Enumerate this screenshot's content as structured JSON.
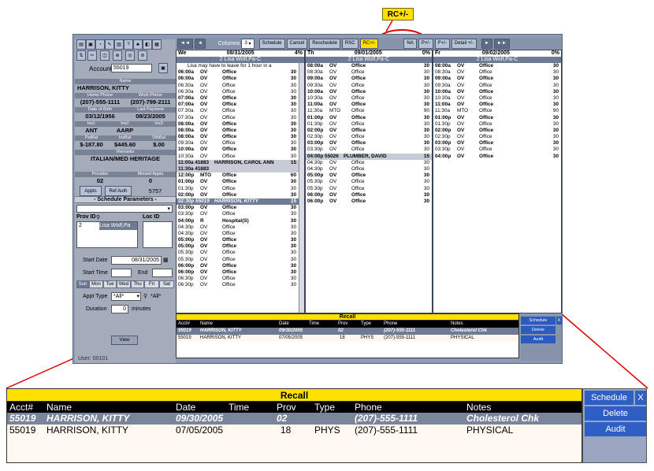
{
  "callout": {
    "label": "RC+/-"
  },
  "toolbar": {
    "nav_first": "◄◄",
    "nav_prev": "◄",
    "columns_label": "Columns",
    "columns_value": "3",
    "schedule": "Schedule",
    "cancel": "Cancel",
    "reschedule": "Reschedule",
    "rsc": "RSC",
    "rc_plus_minus": "RC+/-",
    "na": "NA",
    "p_plus": "P+/-",
    "f_plus": "F+/-",
    "detail": "Detail +/-",
    "nav_next": "►",
    "nav_last": "►►"
  },
  "account": {
    "label": "Account",
    "value": "55019",
    "name_label": "Name",
    "name": "HARRISON, KITTY",
    "home_phone_label": "Home Phone",
    "home_phone": "(207)-555-1111",
    "work_phone_label": "Work Phone",
    "work_phone": "(207)-799-2111",
    "dob_label": "Date of Birth",
    "dob": "03/12/1956",
    "last_payment_label": "Last Payment",
    "last_payment": "08/23/2005",
    "ins1_label": "Ins1",
    "ins1": "ANT",
    "ins2_label": "Ins2",
    "ins2": "AARP",
    "ins3_label": "Ins3",
    "patbal_label": "PatBal",
    "patbal": "$-187.80",
    "insbal_label": "InsBal",
    "insbal": "$445.60",
    "othbal_label": "OthBal",
    "othbal": "$.00",
    "remarks_label": "Remarks",
    "remarks": "ITALIAN/MED HERITAGE",
    "provider_label": "Provider",
    "provider": "02",
    "missed_label": "Missed Appts",
    "missed": "0",
    "appts_btn": "Appts",
    "refauth_btn": "Ref Auth",
    "auth_value": "5757"
  },
  "params": {
    "title": "- Schedule Parameters -",
    "prov_id_label": "Prov ID",
    "loc_id_label": "Loc ID",
    "prov_id": "2",
    "prov_name": "Lisa Wolf,Pa",
    "start_date_label": "Start Date",
    "start_date": "08/31/2005",
    "start_time_label": "Start Time",
    "end_label": "End",
    "days": [
      "Sun",
      "Mon",
      "Tue",
      "Wed",
      "Thu",
      "Fri",
      "Sat"
    ],
    "appt_type_label": "Appt Type",
    "appt_type": "*All*",
    "appt_type2": "*All*",
    "duration_label": "Duration",
    "duration": "0",
    "minutes": "minutes",
    "view_btn": "View",
    "user_label": "User: 00101"
  },
  "columns": [
    {
      "day": "We",
      "date": "08/31/2005",
      "pct": "4%",
      "provider": "2 Lisa Wolf,Pa-C",
      "note": "Lisa may have to leave for 1 hour in a",
      "slots": [
        [
          "06:00a",
          "OV",
          "Office",
          "30",
          ""
        ],
        [
          "06:00a",
          "OV",
          "Office",
          "30",
          ""
        ],
        [
          "06:30a",
          "OV",
          "Office",
          "30",
          ""
        ],
        [
          "06:30a",
          "OV",
          "Office",
          "30",
          ""
        ],
        [
          "07:00a",
          "OV",
          "Office",
          "30",
          ""
        ],
        [
          "07:00a",
          "OV",
          "Office",
          "30",
          ""
        ],
        [
          "07:30a",
          "OV",
          "Office",
          "30",
          ""
        ],
        [
          "07:30a",
          "OV",
          "Office",
          "30",
          ""
        ],
        [
          "08:00a",
          "OV",
          "Office",
          "30",
          ""
        ],
        [
          "08:00a",
          "OV",
          "Office",
          "30",
          ""
        ],
        [
          "08:00a",
          "OV",
          "Office",
          "30",
          ""
        ],
        [
          "09:30a",
          "OV",
          "Office",
          "30",
          ""
        ],
        [
          "10:00a",
          "OV",
          "Office",
          "30",
          ""
        ],
        [
          "10:30a",
          "OV",
          "Office",
          "30",
          ""
        ],
        [
          "11:00a 41883",
          "HARRISON, CAROL ANN",
          "",
          "15",
          "hl"
        ],
        [
          "11:30a 41883",
          "",
          "",
          "",
          "hl"
        ],
        [
          "12:00p",
          "MTO",
          "Office",
          "60",
          ""
        ],
        [
          "01:00p",
          "OV",
          "Office",
          "30",
          ""
        ],
        [
          "01:30p",
          "OV",
          "Office",
          "30",
          ""
        ],
        [
          "02:00p",
          "OV",
          "Office",
          "30",
          ""
        ],
        [
          "02:30p 55019",
          "HARRISON, KITTY",
          "",
          "15",
          "sel"
        ],
        [
          "03:00p",
          "OV",
          "Office",
          "30",
          ""
        ],
        [
          "03:30p",
          "OV",
          "Office",
          "30",
          ""
        ],
        [
          "04:00p",
          "R",
          "Hospital(S)",
          "30",
          ""
        ],
        [
          "04:30p",
          "OV",
          "Office",
          "30",
          ""
        ],
        [
          "04:30p",
          "OV",
          "Office",
          "30",
          ""
        ],
        [
          "05:00p",
          "OV",
          "Office",
          "30",
          ""
        ],
        [
          "05:00p",
          "OV",
          "Office",
          "30",
          ""
        ],
        [
          "05:30p",
          "OV",
          "Office",
          "30",
          ""
        ],
        [
          "05:30p",
          "OV",
          "Office",
          "30",
          ""
        ],
        [
          "06:00p",
          "OV",
          "Office",
          "30",
          ""
        ],
        [
          "06:00p",
          "OV",
          "Office",
          "30",
          ""
        ],
        [
          "06:30p",
          "OV",
          "Office",
          "30",
          ""
        ],
        [
          "06:30p",
          "OV",
          "Office",
          "30",
          ""
        ]
      ]
    },
    {
      "day": "Th",
      "date": "09/01/2005",
      "pct": "0%",
      "provider": "2 Lisa Wolf,Pa-C",
      "note": "",
      "slots": [
        [
          "08:00a",
          "OV",
          "Office",
          "30",
          ""
        ],
        [
          "08:30a",
          "OV",
          "Office",
          "30",
          ""
        ],
        [
          "09:00a",
          "OV",
          "Office",
          "30",
          ""
        ],
        [
          "09:30a",
          "OV",
          "Office",
          "30",
          ""
        ],
        [
          "10:00a",
          "OV",
          "Office",
          "30",
          ""
        ],
        [
          "10:30a",
          "OV",
          "Office",
          "30",
          ""
        ],
        [
          "11:00a",
          "OV",
          "Office",
          "30",
          ""
        ],
        [
          "11:30a",
          "MTO",
          "Office",
          "90",
          ""
        ],
        [
          "01:00p",
          "OV",
          "Office",
          "30",
          ""
        ],
        [
          "01:30p",
          "OV",
          "Office",
          "30",
          ""
        ],
        [
          "02:00p",
          "OV",
          "Office",
          "30",
          ""
        ],
        [
          "02:30p",
          "OV",
          "Office",
          "30",
          ""
        ],
        [
          "03:00p",
          "OV",
          "Office",
          "30",
          ""
        ],
        [
          "03:30p",
          "OV",
          "Office",
          "30",
          ""
        ],
        [
          "04:00p 55026",
          "PLUMBER, DAVID",
          "",
          "15",
          "hl"
        ],
        [
          "04:30p",
          "OV",
          "Office",
          "30",
          ""
        ],
        [
          "04:30p",
          "OV",
          "Office",
          "30",
          ""
        ],
        [
          "05:00p",
          "OV",
          "Office",
          "30",
          ""
        ],
        [
          "05:30p",
          "OV",
          "Office",
          "30",
          ""
        ],
        [
          "05:30p",
          "OV",
          "Office",
          "30",
          ""
        ],
        [
          "06:00p",
          "OV",
          "Office",
          "30",
          ""
        ],
        [
          "06:00p",
          "OV",
          "Office",
          "30",
          ""
        ]
      ]
    },
    {
      "day": "Fr",
      "date": "09/02/2005",
      "pct": "0%",
      "provider": "2 Lisa Wolf,Pa-C",
      "note": "",
      "slots": [
        [
          "08:00a",
          "OV",
          "Office",
          "30",
          ""
        ],
        [
          "08:30a",
          "OV",
          "Office",
          "30",
          ""
        ],
        [
          "09:00a",
          "OV",
          "Office",
          "30",
          ""
        ],
        [
          "09:30a",
          "OV",
          "Office",
          "30",
          ""
        ],
        [
          "10:00a",
          "OV",
          "Office",
          "30",
          ""
        ],
        [
          "10:30a",
          "OV",
          "Office",
          "30",
          ""
        ],
        [
          "11:00a",
          "OV",
          "Office",
          "30",
          ""
        ],
        [
          "11:30a",
          "MTO",
          "Office",
          "90",
          ""
        ],
        [
          "01:00p",
          "OV",
          "Office",
          "30",
          ""
        ],
        [
          "01:30p",
          "OV",
          "Office",
          "30",
          ""
        ],
        [
          "02:00p",
          "OV",
          "Office",
          "30",
          ""
        ],
        [
          "02:30p",
          "OV",
          "Office",
          "30",
          ""
        ],
        [
          "03:00p",
          "OV",
          "Office",
          "30",
          ""
        ],
        [
          "03:30p",
          "OV",
          "Office",
          "30",
          ""
        ],
        [
          "04:00p",
          "OV",
          "Office",
          "30",
          ""
        ]
      ]
    }
  ],
  "recall": {
    "title": "Recall",
    "headers": [
      "Acct#",
      "Name",
      "Date",
      "Time",
      "Prov",
      "Type",
      "Phone",
      "Notes"
    ],
    "rows": [
      [
        "55019",
        "HARRISON, KITTY",
        "09/30/2005",
        "",
        "02",
        "",
        "(207)-555-1111",
        "Cholesterol Chk"
      ],
      [
        "55019",
        "HARRISON, KITTY",
        "07/05/2005",
        "",
        "18",
        "PHYS",
        "(207)-555-1111",
        "PHYSICAL"
      ]
    ],
    "buttons": {
      "schedule": "Schedule",
      "close": "X",
      "delete": "Delete",
      "audit": "Audit"
    }
  }
}
